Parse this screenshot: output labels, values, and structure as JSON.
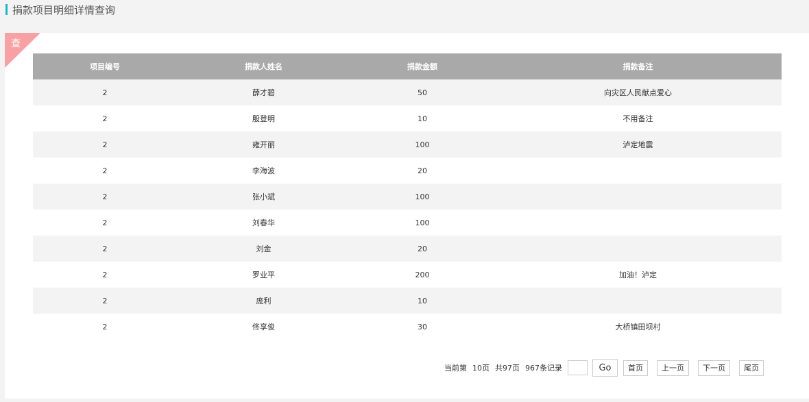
{
  "header": {
    "title": "捐款项目明细详情查询"
  },
  "panel": {
    "corner_label": "查"
  },
  "table": {
    "columns": [
      "项目编号",
      "捐款人姓名",
      "捐款金额",
      "捐款备注"
    ],
    "rows": [
      [
        "2",
        "薛才碧",
        "50",
        "向灾区人民献点爱心"
      ],
      [
        "2",
        "殷登明",
        "10",
        "不用备注"
      ],
      [
        "2",
        "雍开丽",
        "100",
        "泸定地震"
      ],
      [
        "2",
        "李海波",
        "20",
        ""
      ],
      [
        "2",
        "张小斌",
        "100",
        ""
      ],
      [
        "2",
        "刘春华",
        "100",
        ""
      ],
      [
        "2",
        "刘金",
        "20",
        ""
      ],
      [
        "2",
        "罗业平",
        "200",
        "加油！泸定"
      ],
      [
        "2",
        "庞利",
        "10",
        ""
      ],
      [
        "2",
        "佟享俊",
        "30",
        "大桥镇田坝村"
      ]
    ]
  },
  "pager": {
    "current_label": "当前第",
    "current_page": "10页",
    "total_pages": "共97页",
    "total_records": "967条记录",
    "page_input_value": "",
    "go_label": "Go",
    "first_label": "首页",
    "prev_label": "上一页",
    "next_label": "下一页",
    "last_label": "尾页"
  },
  "colors": {
    "accent": "#1fb5c9",
    "corner": "#f7a1a4",
    "header_bg": "#a9a9a9"
  }
}
